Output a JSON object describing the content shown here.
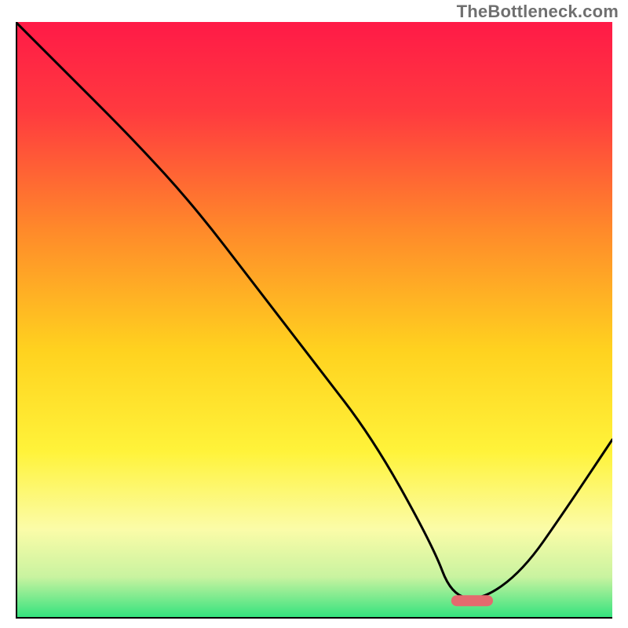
{
  "watermark": "TheBottleneck.com",
  "chart_data": {
    "type": "line",
    "title": "",
    "xlabel": "",
    "ylabel": "",
    "xlim": [
      0,
      100
    ],
    "ylim": [
      0,
      100
    ],
    "series": [
      {
        "name": "bottleneck-curve",
        "x": [
          0,
          8,
          20,
          30,
          40,
          50,
          60,
          70,
          73,
          78,
          85,
          92,
          100
        ],
        "values": [
          100,
          92,
          80,
          69,
          56,
          43,
          30,
          12,
          4,
          3,
          8,
          18,
          30
        ]
      }
    ],
    "marker": {
      "name": "highlight",
      "x_start": 73,
      "x_end": 80,
      "y": 3
    },
    "gradient_stops": [
      {
        "offset": 0.0,
        "color": "#ff1a47"
      },
      {
        "offset": 0.15,
        "color": "#ff3a3f"
      },
      {
        "offset": 0.35,
        "color": "#ff8a2a"
      },
      {
        "offset": 0.55,
        "color": "#ffd21f"
      },
      {
        "offset": 0.72,
        "color": "#fff33a"
      },
      {
        "offset": 0.85,
        "color": "#fbfca8"
      },
      {
        "offset": 0.93,
        "color": "#c9f3a0"
      },
      {
        "offset": 1.0,
        "color": "#2fe27d"
      }
    ],
    "axis_color": "#000000",
    "axis_width": 4,
    "curve_color": "#000000",
    "curve_width": 3,
    "marker_color": "#e46a6e",
    "marker_height": 14,
    "marker_radius": 7
  }
}
